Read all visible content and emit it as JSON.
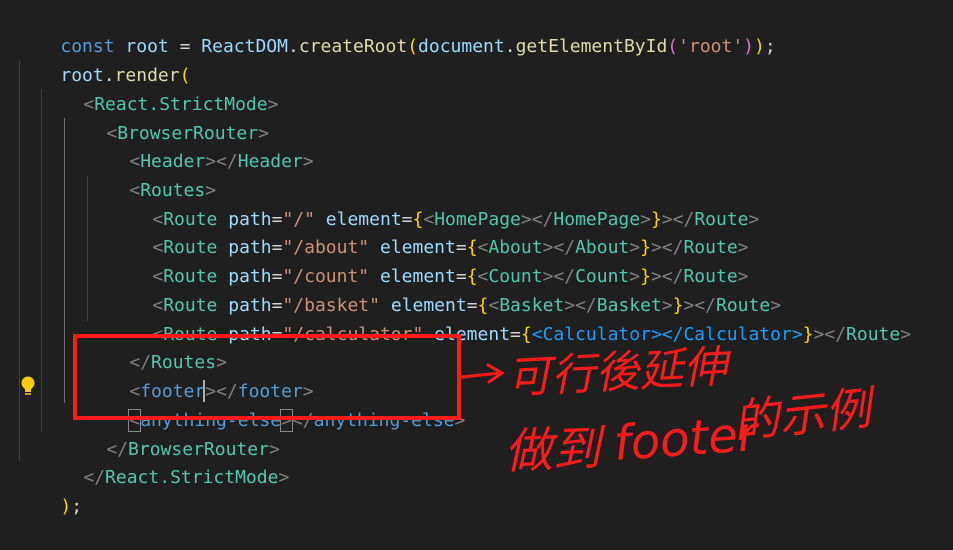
{
  "code": {
    "l1": {
      "p1": "const",
      "p2": " ",
      "p3": "root",
      "p4": " = ",
      "p5": "ReactDOM",
      "p6": ".",
      "p7": "createRoot",
      "p8": "(",
      "p9": "document",
      "p10": ".",
      "p11": "getElementById",
      "p12": "(",
      "p13": "'root'",
      "p14": ")",
      "p15": ")",
      "p16": ";"
    },
    "l2": {
      "p1": "root",
      "p2": ".",
      "p3": "render",
      "p4": "("
    },
    "l3": {
      "p1": "<",
      "p2": "React.StrictMode",
      "p3": ">"
    },
    "l4": {
      "p1": "<",
      "p2": "BrowserRouter",
      "p3": ">"
    },
    "l5": {
      "p1": "<",
      "p2": "Header",
      "p3": "></",
      "p4": "Header",
      "p5": ">"
    },
    "l6": {
      "p1": "<",
      "p2": "Routes",
      "p3": ">"
    },
    "routes": [
      {
        "open": "<",
        "tag": "Route",
        "attr1": "path",
        "eq1": "=",
        "path": "\"/\"",
        "attr2": "element",
        "eq2": "=",
        "lb": "{",
        "lt": "<",
        "comp": "HomePage",
        "mid": "></",
        "comp2": "HomePage",
        "gt": ">",
        "rb": "}",
        "close1": "></",
        "closetag": "Route",
        "close2": ">"
      },
      {
        "open": "<",
        "tag": "Route",
        "attr1": "path",
        "eq1": "=",
        "path": "\"/about\"",
        "attr2": "element",
        "eq2": "=",
        "lb": "{",
        "lt": "<",
        "comp": "About",
        "mid": "></",
        "comp2": "About",
        "gt": ">",
        "rb": "}",
        "close1": "></",
        "closetag": "Route",
        "close2": ">"
      },
      {
        "open": "<",
        "tag": "Route",
        "attr1": "path",
        "eq1": "=",
        "path": "\"/count\"",
        "attr2": "element",
        "eq2": "=",
        "lb": "{",
        "lt": "<",
        "comp": "Count",
        "mid": "></",
        "comp2": "Count",
        "gt": ">",
        "rb": "}",
        "close1": "></",
        "closetag": "Route",
        "close2": ">"
      },
      {
        "open": "<",
        "tag": "Route",
        "attr1": "path",
        "eq1": "=",
        "path": "\"/basket\"",
        "attr2": "element",
        "eq2": "=",
        "lb": "{",
        "lt": "<",
        "comp": "Basket",
        "mid": "></",
        "comp2": "Basket",
        "gt": ">",
        "rb": "}",
        "close1": "></",
        "closetag": "Route",
        "close2": ">"
      },
      {
        "open": "<",
        "tag": "Route",
        "attr1": "path",
        "eq1": "=",
        "path": "\"/calculator\"",
        "attr2": "element",
        "eq2": "=",
        "lb": "{",
        "lt": "<",
        "comp": "Calculator",
        "mid": "></",
        "comp2": "Calculator",
        "gt": ">",
        "rb": "}",
        "close1": "></",
        "closetag": "Route",
        "close2": ">"
      }
    ],
    "l12": {
      "p1": "</",
      "p2": "Routes",
      "p3": ">"
    },
    "l13": {
      "p1": "<",
      "p2": "footer",
      "p3": "></",
      "p4": "footer",
      "p5": ">"
    },
    "l14": {
      "p1": "<",
      "p2": "anything-",
      "p3": "else",
      "p4": ">",
      "p5": "</",
      "p6": "anything-else",
      "p7": ">"
    },
    "l15": {
      "p1": "</",
      "p2": "BrowserRouter",
      "p3": ">"
    },
    "l16": {
      "p1": "</",
      "p2": "React.StrictMode",
      "p3": ">"
    },
    "l17": {
      "p1": ")",
      "p2": ";"
    }
  },
  "annotation": {
    "line1": "可行後延伸",
    "line2_a": "做到",
    "line2_b": "footer",
    "line2_c": "的示例",
    "color": "#ff1a1a"
  },
  "theme": {
    "background": "#1f1f1f",
    "keyword": "#569cd6",
    "variable": "#9cdcfe",
    "function": "#dcdcaa",
    "component": "#4ec9b0",
    "string": "#ce9178"
  },
  "icons": {
    "bulb": "lightbulb-icon"
  }
}
